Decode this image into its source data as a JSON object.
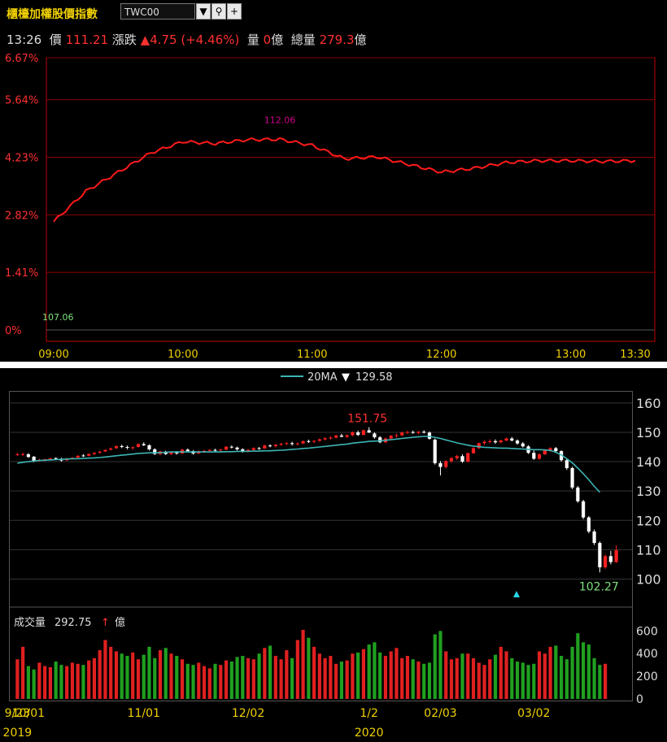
{
  "header": {
    "title": "櫃檯加權股價指數",
    "symbol": "TWC00",
    "time": "13:26",
    "price_label": "價",
    "price": "111.21",
    "change_label": "漲跌",
    "change_arrow": "▲",
    "change": "4.75",
    "change_pct": "(+4.46%)",
    "vol_label": "量",
    "vol": "0",
    "vol_unit": "億",
    "total_label": "總量",
    "total": "279.3",
    "total_unit": "億"
  },
  "colors": {
    "up": "#ff2020",
    "down": "#20b020",
    "ma": "#3cb4b4",
    "gold": "#f0d000",
    "grid": "#8b0000"
  },
  "chart_data": [
    {
      "type": "line",
      "series": [
        {
          "x": [
            "09:00",
            "09:15",
            "09:30",
            "09:45",
            "10:00",
            "10:15",
            "10:30",
            "10:45",
            "11:00",
            "11:15",
            "11:30",
            "11:45",
            "12:00",
            "12:15",
            "12:30",
            "12:45",
            "13:00",
            "13:15",
            "13:30"
          ],
          "values": [
            109.9,
            110.7,
            111.2,
            111.7,
            112.0,
            111.95,
            112.05,
            112.06,
            111.9,
            111.55,
            111.6,
            111.4,
            111.2,
            111.3,
            111.45,
            111.5,
            111.5,
            111.48,
            111.5
          ]
        }
      ],
      "ytick_labels": [
        "6.67%",
        "5.64%",
        "4.23%",
        "2.82%",
        "1.41%",
        "0%"
      ],
      "ytick_pct": [
        6.67,
        5.64,
        4.23,
        2.82,
        1.41,
        0
      ],
      "xtick_labels": [
        "09:00",
        "10:00",
        "11:00",
        "12:00",
        "13:00",
        "13:30"
      ],
      "xtick_minutes": [
        0,
        60,
        120,
        180,
        240,
        270
      ],
      "base": 107.06,
      "high_label": "112.06",
      "base_label": "107.06",
      "ylim": [
        107.06,
        114.2
      ]
    },
    {
      "type": "candlestick",
      "legend": {
        "name": "20MA",
        "arrow": "▼",
        "value": "129.58"
      },
      "yticks": [
        160,
        150,
        140,
        130,
        120,
        110,
        100
      ],
      "ylim": [
        91,
        163
      ],
      "max_label": "151.75",
      "min_label": "102.27",
      "xtick_labels": [
        "9/23",
        "10/01",
        "11/01",
        "12/02",
        "1/2",
        "02/03",
        "03/02"
      ],
      "xtick_index": [
        0,
        2,
        23,
        42,
        64,
        77,
        94
      ],
      "year_labels": [
        "2019",
        "2020"
      ],
      "year_index": [
        0,
        64
      ],
      "ohlc": [
        [
          142.5,
          143.0,
          142.0,
          142.5
        ],
        [
          142.6,
          143.1,
          142.0,
          142.6
        ],
        [
          142.5,
          142.9,
          141.3,
          141.6
        ],
        [
          141.7,
          141.9,
          139.8,
          140.3
        ],
        [
          140.5,
          141.0,
          140.0,
          140.6
        ],
        [
          140.7,
          141.0,
          140.1,
          140.8
        ],
        [
          140.9,
          141.3,
          140.4,
          141.1
        ],
        [
          141.2,
          141.5,
          140.7,
          140.9
        ],
        [
          141.0,
          141.3,
          140.0,
          140.4
        ],
        [
          140.5,
          141.2,
          140.2,
          141.0
        ],
        [
          141.1,
          141.6,
          140.7,
          141.3
        ],
        [
          141.4,
          142.2,
          141.2,
          142.0
        ],
        [
          142.1,
          142.6,
          141.6,
          141.9
        ],
        [
          142.0,
          142.9,
          141.8,
          142.6
        ],
        [
          142.6,
          143.2,
          142.3,
          143.0
        ],
        [
          143.1,
          143.7,
          142.7,
          143.4
        ],
        [
          143.5,
          144.2,
          143.3,
          144.0
        ],
        [
          144.1,
          144.8,
          143.8,
          144.5
        ],
        [
          144.6,
          145.6,
          144.3,
          145.3
        ],
        [
          145.3,
          145.8,
          144.6,
          145.0
        ],
        [
          145.0,
          145.5,
          144.2,
          144.8
        ],
        [
          144.9,
          145.2,
          144.1,
          144.9
        ],
        [
          145.0,
          146.2,
          144.8,
          146.0
        ],
        [
          146.0,
          146.6,
          145.3,
          145.6
        ],
        [
          145.6,
          145.9,
          143.8,
          144.2
        ],
        [
          144.2,
          144.6,
          142.3,
          142.6
        ],
        [
          142.6,
          143.8,
          142.2,
          143.5
        ],
        [
          143.4,
          143.7,
          142.3,
          142.6
        ],
        [
          142.6,
          143.5,
          142.3,
          143.1
        ],
        [
          143.1,
          143.6,
          142.4,
          142.8
        ],
        [
          142.8,
          144.4,
          142.6,
          144.1
        ],
        [
          144.1,
          144.5,
          143.2,
          143.6
        ],
        [
          143.6,
          143.9,
          142.4,
          142.8
        ],
        [
          142.8,
          143.8,
          142.6,
          143.5
        ],
        [
          143.5,
          144.0,
          143.0,
          143.7
        ],
        [
          143.7,
          144.3,
          143.3,
          144.0
        ],
        [
          144.0,
          144.4,
          143.4,
          143.9
        ],
        [
          143.9,
          144.4,
          143.3,
          144.1
        ],
        [
          144.1,
          145.3,
          143.9,
          145.1
        ],
        [
          145.1,
          145.5,
          144.5,
          144.9
        ],
        [
          144.8,
          145.1,
          143.8,
          144.2
        ],
        [
          144.2,
          144.6,
          143.1,
          143.5
        ],
        [
          143.5,
          144.3,
          143.2,
          144.0
        ],
        [
          144.0,
          144.9,
          143.7,
          144.6
        ],
        [
          144.6,
          145.0,
          144.0,
          144.5
        ],
        [
          144.5,
          145.8,
          144.4,
          145.5
        ],
        [
          145.5,
          145.9,
          144.9,
          145.3
        ],
        [
          145.3,
          146.0,
          144.8,
          145.8
        ],
        [
          145.8,
          146.4,
          145.4,
          146.1
        ],
        [
          146.1,
          146.7,
          145.7,
          146.3
        ],
        [
          146.3,
          146.8,
          145.5,
          146.0
        ],
        [
          146.0,
          146.5,
          145.5,
          146.2
        ],
        [
          146.2,
          147.2,
          146.0,
          147.0
        ],
        [
          147.0,
          147.5,
          146.4,
          146.8
        ],
        [
          146.8,
          147.3,
          146.3,
          147.1
        ],
        [
          147.1,
          147.9,
          146.8,
          147.6
        ],
        [
          147.6,
          148.3,
          147.2,
          148.0
        ],
        [
          148.0,
          148.6,
          147.5,
          148.2
        ],
        [
          148.2,
          149.2,
          147.9,
          148.9
        ],
        [
          148.9,
          149.5,
          148.3,
          148.5
        ],
        [
          148.5,
          149.3,
          148.0,
          149.0
        ],
        [
          149.0,
          150.3,
          148.7,
          150.0
        ],
        [
          150.0,
          150.6,
          148.8,
          149.1
        ],
        [
          149.1,
          151.0,
          149.0,
          150.7
        ],
        [
          150.7,
          151.75,
          149.8,
          149.9
        ],
        [
          149.6,
          150.0,
          147.8,
          148.3
        ],
        [
          148.3,
          148.7,
          146.3,
          146.6
        ],
        [
          146.6,
          148.2,
          146.3,
          147.9
        ],
        [
          147.9,
          149.1,
          147.6,
          148.8
        ],
        [
          148.8,
          149.6,
          148.2,
          149.0
        ],
        [
          149.0,
          150.2,
          148.7,
          149.9
        ],
        [
          149.9,
          150.5,
          149.4,
          150.1
        ],
        [
          150.1,
          150.6,
          149.5,
          149.8
        ],
        [
          149.8,
          150.4,
          149.3,
          150.2
        ],
        [
          150.2,
          150.7,
          149.6,
          149.9
        ],
        [
          149.9,
          150.3,
          147.5,
          147.8
        ],
        [
          147.5,
          147.9,
          139.0,
          139.5
        ],
        [
          139.5,
          140.2,
          135.3,
          138.2
        ],
        [
          138.2,
          140.5,
          137.7,
          140.2
        ],
        [
          140.2,
          141.6,
          139.6,
          141.2
        ],
        [
          141.2,
          142.3,
          140.6,
          141.9
        ],
        [
          141.9,
          142.5,
          139.6,
          140.0
        ],
        [
          140.0,
          143.1,
          139.8,
          142.9
        ],
        [
          142.9,
          144.9,
          142.6,
          144.6
        ],
        [
          144.6,
          146.5,
          144.3,
          146.3
        ],
        [
          146.3,
          147.3,
          145.7,
          146.8
        ],
        [
          146.8,
          147.6,
          146.2,
          147.0
        ],
        [
          147.0,
          147.6,
          146.1,
          146.6
        ],
        [
          146.6,
          147.5,
          146.3,
          147.2
        ],
        [
          147.2,
          148.2,
          147.0,
          147.9
        ],
        [
          147.9,
          148.4,
          146.9,
          147.2
        ],
        [
          147.2,
          147.6,
          145.8,
          146.2
        ],
        [
          146.2,
          146.7,
          144.8,
          145.2
        ],
        [
          145.2,
          145.6,
          142.6,
          143.0
        ],
        [
          143.0,
          143.8,
          140.6,
          141.0
        ],
        [
          141.0,
          142.9,
          140.6,
          142.5
        ],
        [
          142.5,
          144.2,
          142.3,
          143.9
        ],
        [
          143.9,
          144.9,
          143.4,
          144.6
        ],
        [
          144.6,
          145.0,
          143.0,
          143.6
        ],
        [
          143.6,
          143.9,
          140.0,
          140.5
        ],
        [
          140.5,
          141.0,
          137.2,
          137.8
        ],
        [
          137.8,
          138.3,
          130.6,
          131.2
        ],
        [
          131.2,
          131.7,
          126.0,
          126.5
        ],
        [
          126.5,
          127.0,
          120.4,
          121.0
        ],
        [
          121.0,
          121.5,
          115.6,
          116.2
        ],
        [
          116.2,
          116.9,
          111.6,
          112.3
        ],
        [
          112.3,
          112.8,
          102.27,
          104.0
        ],
        [
          104.0,
          108.4,
          103.5,
          107.8
        ],
        [
          107.8,
          109.6,
          105.0,
          105.8
        ],
        [
          105.8,
          111.5,
          105.5,
          109.8
        ]
      ],
      "ma20": [
        139.5,
        139.8,
        140.0,
        140.2,
        140.4,
        140.5,
        140.6,
        140.7,
        140.8,
        140.9,
        141.0,
        141.0,
        141.1,
        141.2,
        141.3,
        141.4,
        141.6,
        141.8,
        142.0,
        142.2,
        142.4,
        142.6,
        142.8,
        142.9,
        143.0,
        143.0,
        143.1,
        143.2,
        143.3,
        143.3,
        143.3,
        143.3,
        143.3,
        143.3,
        143.3,
        143.3,
        143.3,
        143.3,
        143.4,
        143.4,
        143.5,
        143.5,
        143.5,
        143.6,
        143.6,
        143.7,
        143.7,
        143.8,
        143.9,
        144.0,
        144.2,
        144.3,
        144.5,
        144.6,
        144.8,
        145.0,
        145.2,
        145.4,
        145.6,
        145.8,
        146.0,
        146.3,
        146.5,
        146.7,
        146.9,
        147.0,
        147.1,
        147.3,
        147.5,
        147.7,
        147.9,
        148.1,
        148.3,
        148.5,
        148.6,
        148.6,
        148.3,
        147.9,
        147.4,
        146.9,
        146.4,
        146.0,
        145.6,
        145.3,
        145.1,
        144.9,
        144.8,
        144.7,
        144.6,
        144.6,
        144.5,
        144.4,
        144.3,
        144.2,
        144.1,
        144.1,
        144.0,
        143.8,
        143.2,
        142.3,
        141.0,
        139.6,
        137.8,
        135.9,
        133.8,
        131.6,
        129.58
      ],
      "volume_label": "成交量",
      "volume_value": "292.75",
      "volume_unit": "億",
      "volume_yticks": [
        600,
        400,
        200,
        0
      ],
      "volume_ylim": [
        0,
        660
      ],
      "volume": [
        350,
        460,
        290,
        260,
        320,
        290,
        280,
        330,
        300,
        290,
        320,
        310,
        300,
        340,
        360,
        430,
        520,
        460,
        420,
        400,
        380,
        410,
        350,
        390,
        460,
        360,
        430,
        450,
        400,
        380,
        350,
        310,
        300,
        320,
        290,
        270,
        310,
        300,
        340,
        330,
        370,
        380,
        360,
        350,
        400,
        450,
        470,
        380,
        350,
        430,
        360,
        520,
        610,
        540,
        460,
        400,
        360,
        380,
        310,
        330,
        340,
        400,
        410,
        440,
        480,
        500,
        410,
        380,
        420,
        450,
        360,
        380,
        350,
        330,
        310,
        320,
        570,
        600,
        420,
        350,
        360,
        400,
        400,
        360,
        320,
        300,
        350,
        390,
        460,
        420,
        360,
        330,
        320,
        300,
        310,
        420,
        400,
        460,
        470,
        380,
        350,
        460,
        580,
        500,
        480,
        360,
        300,
        310
      ]
    }
  ]
}
